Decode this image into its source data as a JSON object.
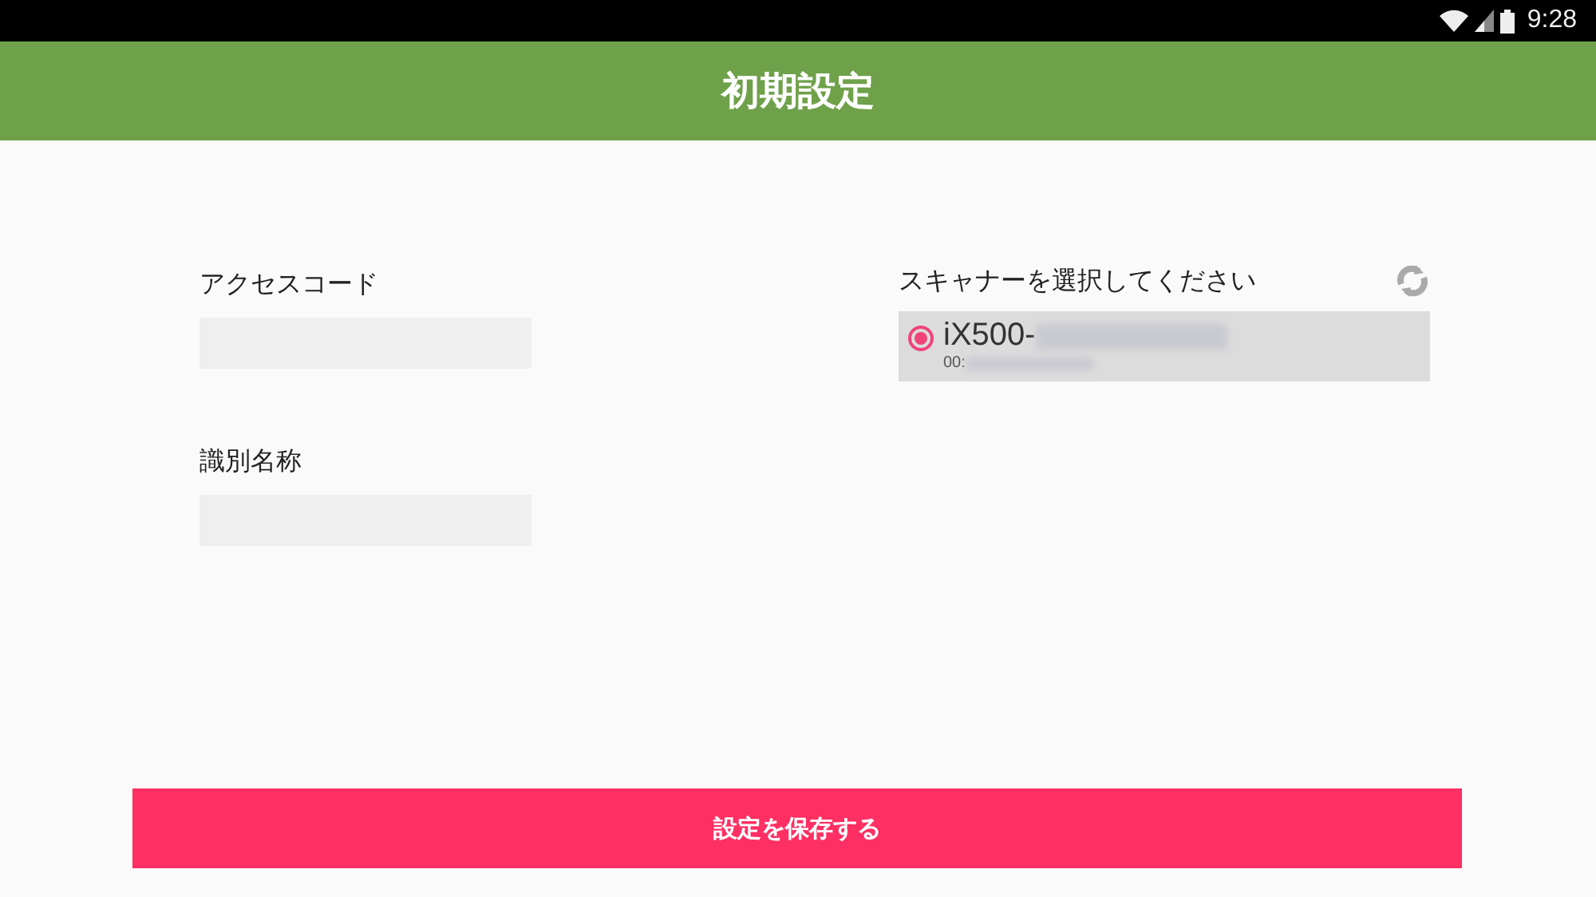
{
  "status_bar": {
    "time": "9:28"
  },
  "header": {
    "title": "初期設定"
  },
  "fields": [
    {
      "label": "アクセスコード"
    },
    {
      "label": "識別名称"
    }
  ],
  "scanners": {
    "label": "スキャナーを選択してください",
    "items": [
      {
        "name": "iX500-",
        "address": "00:",
        "selected": true
      }
    ]
  },
  "save_button": {
    "label": "設定を保存する"
  }
}
